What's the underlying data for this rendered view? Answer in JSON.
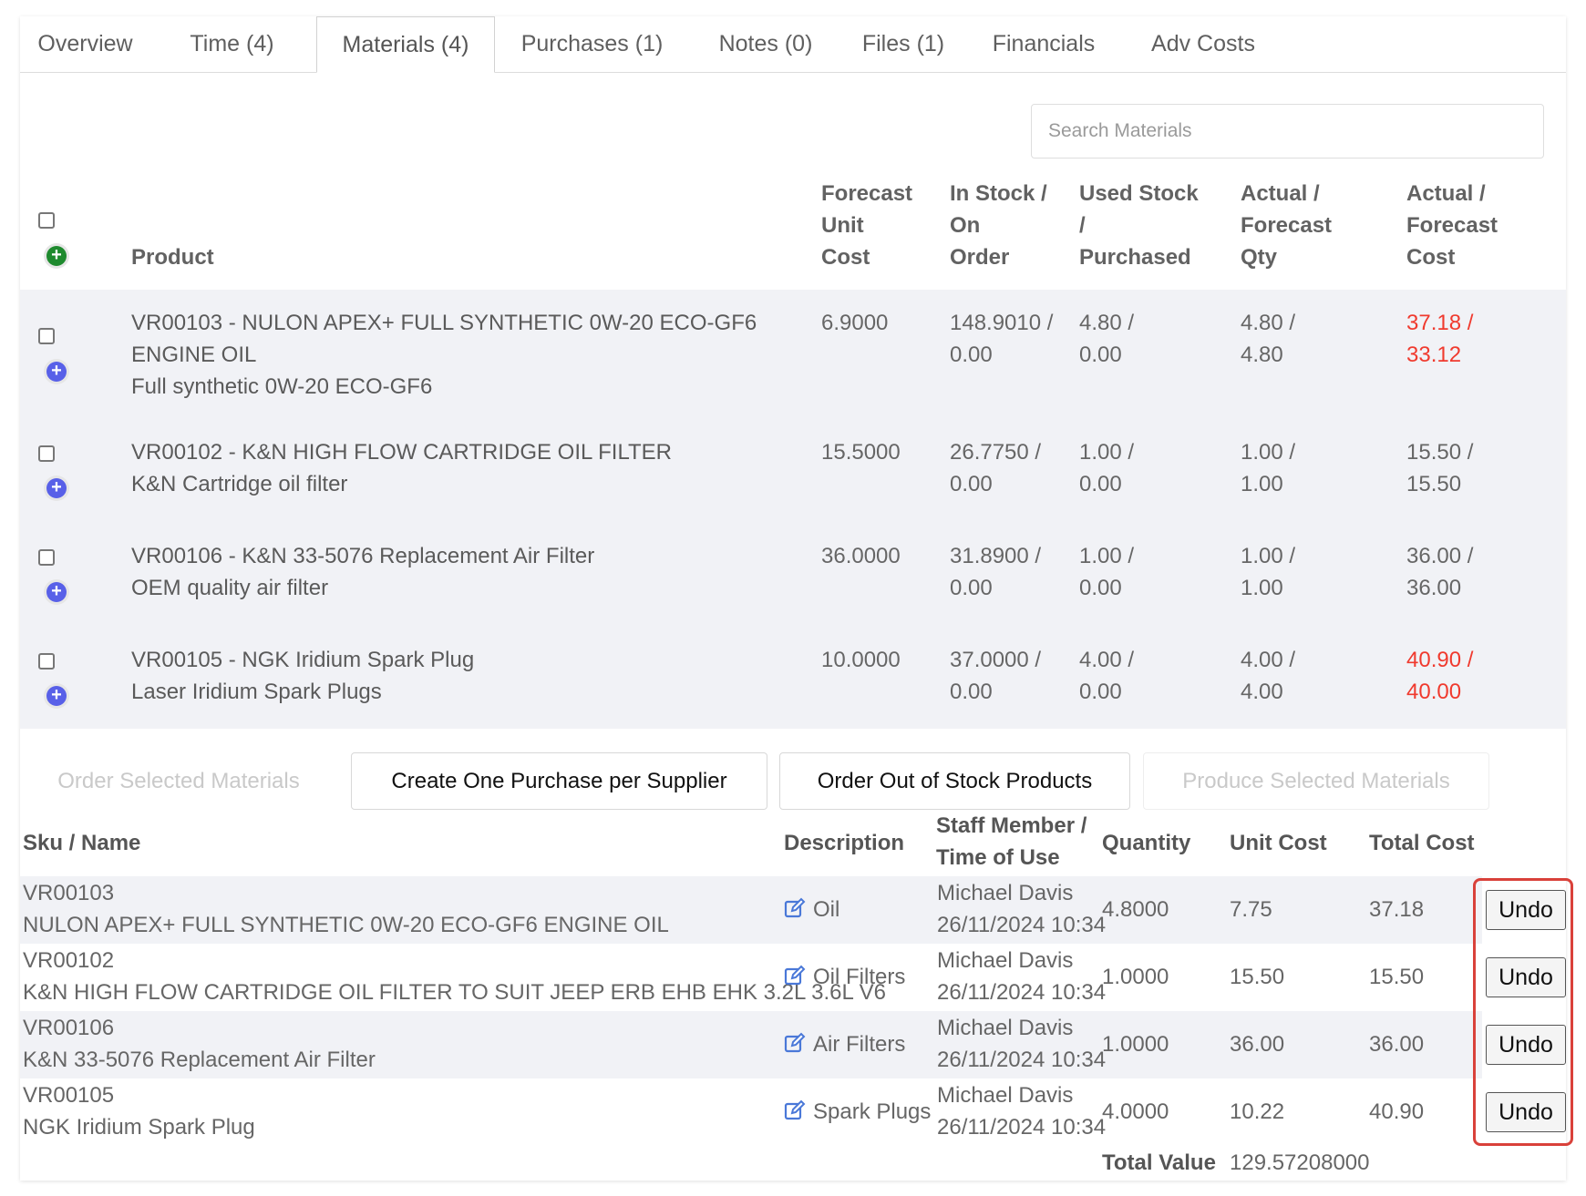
{
  "tabs": [
    {
      "label": "Overview",
      "active": false
    },
    {
      "label": "Time (4)",
      "active": false
    },
    {
      "label": "Materials (4)",
      "active": true
    },
    {
      "label": "Purchases (1)",
      "active": false
    },
    {
      "label": "Notes (0)",
      "active": false
    },
    {
      "label": "Files (1)",
      "active": false
    },
    {
      "label": "Financials",
      "active": false
    },
    {
      "label": "Adv Costs",
      "active": false
    }
  ],
  "search": {
    "placeholder": "Search Materials",
    "value": ""
  },
  "materials_table": {
    "headers": {
      "product": "Product",
      "forecast_unit_cost": [
        "Forecast",
        "Unit",
        "Cost"
      ],
      "in_stock": [
        "In Stock /",
        "On",
        "Order"
      ],
      "used_stock": [
        "Used Stock",
        "/",
        "Purchased"
      ],
      "actual_forecast_qty": [
        "Actual /",
        "Forecast",
        "Qty"
      ],
      "actual_forecast_cost": [
        "Actual /",
        "Forecast",
        "Cost"
      ]
    },
    "rows": [
      {
        "title_line1": "VR00103 - NULON APEX+ FULL SYNTHETIC 0W-20 ECO-GF6",
        "title_line2": "ENGINE OIL",
        "description": "Full synthetic 0W-20 ECO-GF6",
        "forecast_unit_cost": "6.9000",
        "in_stock": "148.9010 /",
        "on_order": "0.00",
        "used_stock": "4.80 /",
        "purchased": "0.00",
        "actual_qty": "4.80 /",
        "forecast_qty": "4.80",
        "actual_cost": "37.18 /",
        "forecast_cost": "33.12",
        "over_budget": true
      },
      {
        "title_line1": "VR00102 - K&N HIGH FLOW CARTRIDGE OIL FILTER",
        "title_line2": "",
        "description": "K&N Cartridge oil filter",
        "forecast_unit_cost": "15.5000",
        "in_stock": "26.7750 /",
        "on_order": "0.00",
        "used_stock": "1.00 /",
        "purchased": "0.00",
        "actual_qty": "1.00 /",
        "forecast_qty": "1.00",
        "actual_cost": "15.50 /",
        "forecast_cost": "15.50",
        "over_budget": false
      },
      {
        "title_line1": "VR00106 - K&N 33-5076 Replacement Air Filter",
        "title_line2": "",
        "description": "OEM quality air filter",
        "forecast_unit_cost": "36.0000",
        "in_stock": "31.8900 /",
        "on_order": "0.00",
        "used_stock": "1.00 /",
        "purchased": "0.00",
        "actual_qty": "1.00 /",
        "forecast_qty": "1.00",
        "actual_cost": "36.00 /",
        "forecast_cost": "36.00",
        "over_budget": false
      },
      {
        "title_line1": "VR00105 - NGK Iridium Spark Plug",
        "title_line2": "",
        "description": "Laser Iridium Spark Plugs",
        "forecast_unit_cost": "10.0000",
        "in_stock": "37.0000 /",
        "on_order": "0.00",
        "used_stock": "4.00 /",
        "purchased": "0.00",
        "actual_qty": "4.00 /",
        "forecast_qty": "4.00",
        "actual_cost": "40.90 /",
        "forecast_cost": "40.00",
        "over_budget": true
      }
    ]
  },
  "actions": {
    "order_selected": "Order Selected Materials",
    "create_purchase": "Create One Purchase per Supplier",
    "order_out_of_stock": "Order Out of Stock Products",
    "produce_selected": "Produce Selected Materials"
  },
  "used_table": {
    "headers": {
      "sku_name": "Sku / Name",
      "description": "Description",
      "staff_line1": "Staff Member /",
      "staff_line2": "Time of Use",
      "quantity": "Quantity",
      "unit_cost": "Unit Cost",
      "total_cost": "Total Cost"
    },
    "rows": [
      {
        "sku": "VR00103",
        "name": "NULON APEX+ FULL SYNTHETIC 0W-20 ECO-GF6 ENGINE OIL",
        "description": "Oil",
        "staff": "Michael Davis",
        "time": "26/11/2024 10:34",
        "quantity": "4.8000",
        "unit_cost": "7.75",
        "total_cost": "37.18",
        "undo": "Undo"
      },
      {
        "sku": "VR00102",
        "name": "K&N HIGH FLOW CARTRIDGE OIL FILTER TO SUIT JEEP ERB EHB EHK 3.2L 3.6L V6",
        "description": "Oil Filters",
        "staff": "Michael Davis",
        "time": "26/11/2024 10:34",
        "quantity": "1.0000",
        "unit_cost": "15.50",
        "total_cost": "15.50",
        "undo": "Undo"
      },
      {
        "sku": "VR00106",
        "name": "K&N 33-5076 Replacement Air Filter",
        "description": "Air Filters",
        "staff": "Michael Davis",
        "time": "26/11/2024 10:34",
        "quantity": "1.0000",
        "unit_cost": "36.00",
        "total_cost": "36.00",
        "undo": "Undo"
      },
      {
        "sku": "VR00105",
        "name": "NGK Iridium Spark Plug",
        "description": "Spark Plugs",
        "staff": "Michael Davis",
        "time": "26/11/2024 10:34",
        "quantity": "4.0000",
        "unit_cost": "10.22",
        "total_cost": "40.90",
        "undo": "Undo"
      }
    ],
    "total_label": "Total Value",
    "total_value": "129.57208000"
  },
  "colors": {
    "over_budget": "#f03a2e",
    "add_all": "#1e8a2e",
    "add_row": "#5860e8",
    "highlight": "#d9413a"
  }
}
